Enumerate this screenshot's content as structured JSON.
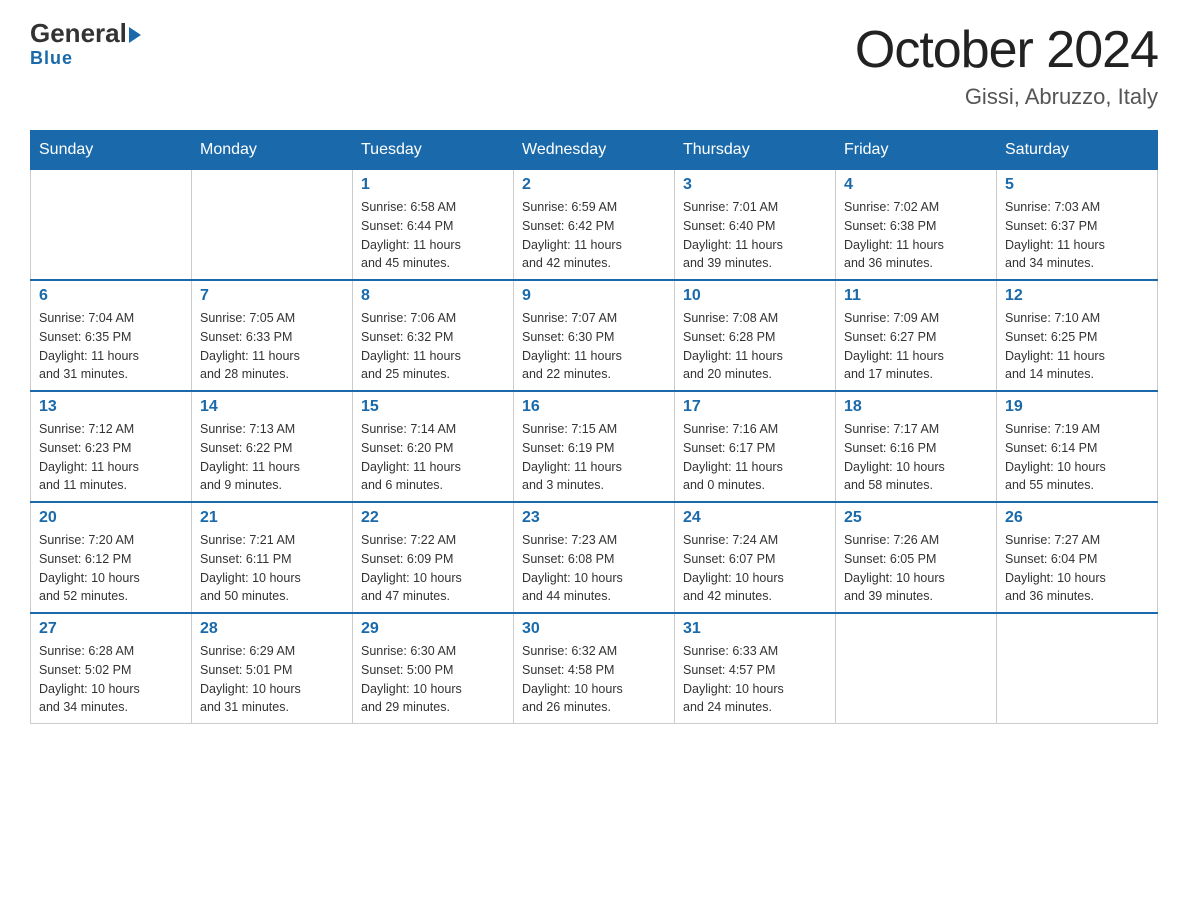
{
  "header": {
    "logo_general": "General",
    "logo_blue": "Blue",
    "month_title": "October 2024",
    "location": "Gissi, Abruzzo, Italy"
  },
  "days_of_week": [
    "Sunday",
    "Monday",
    "Tuesday",
    "Wednesday",
    "Thursday",
    "Friday",
    "Saturday"
  ],
  "weeks": [
    [
      {
        "day": "",
        "info": ""
      },
      {
        "day": "",
        "info": ""
      },
      {
        "day": "1",
        "info": "Sunrise: 6:58 AM\nSunset: 6:44 PM\nDaylight: 11 hours\nand 45 minutes."
      },
      {
        "day": "2",
        "info": "Sunrise: 6:59 AM\nSunset: 6:42 PM\nDaylight: 11 hours\nand 42 minutes."
      },
      {
        "day": "3",
        "info": "Sunrise: 7:01 AM\nSunset: 6:40 PM\nDaylight: 11 hours\nand 39 minutes."
      },
      {
        "day": "4",
        "info": "Sunrise: 7:02 AM\nSunset: 6:38 PM\nDaylight: 11 hours\nand 36 minutes."
      },
      {
        "day": "5",
        "info": "Sunrise: 7:03 AM\nSunset: 6:37 PM\nDaylight: 11 hours\nand 34 minutes."
      }
    ],
    [
      {
        "day": "6",
        "info": "Sunrise: 7:04 AM\nSunset: 6:35 PM\nDaylight: 11 hours\nand 31 minutes."
      },
      {
        "day": "7",
        "info": "Sunrise: 7:05 AM\nSunset: 6:33 PM\nDaylight: 11 hours\nand 28 minutes."
      },
      {
        "day": "8",
        "info": "Sunrise: 7:06 AM\nSunset: 6:32 PM\nDaylight: 11 hours\nand 25 minutes."
      },
      {
        "day": "9",
        "info": "Sunrise: 7:07 AM\nSunset: 6:30 PM\nDaylight: 11 hours\nand 22 minutes."
      },
      {
        "day": "10",
        "info": "Sunrise: 7:08 AM\nSunset: 6:28 PM\nDaylight: 11 hours\nand 20 minutes."
      },
      {
        "day": "11",
        "info": "Sunrise: 7:09 AM\nSunset: 6:27 PM\nDaylight: 11 hours\nand 17 minutes."
      },
      {
        "day": "12",
        "info": "Sunrise: 7:10 AM\nSunset: 6:25 PM\nDaylight: 11 hours\nand 14 minutes."
      }
    ],
    [
      {
        "day": "13",
        "info": "Sunrise: 7:12 AM\nSunset: 6:23 PM\nDaylight: 11 hours\nand 11 minutes."
      },
      {
        "day": "14",
        "info": "Sunrise: 7:13 AM\nSunset: 6:22 PM\nDaylight: 11 hours\nand 9 minutes."
      },
      {
        "day": "15",
        "info": "Sunrise: 7:14 AM\nSunset: 6:20 PM\nDaylight: 11 hours\nand 6 minutes."
      },
      {
        "day": "16",
        "info": "Sunrise: 7:15 AM\nSunset: 6:19 PM\nDaylight: 11 hours\nand 3 minutes."
      },
      {
        "day": "17",
        "info": "Sunrise: 7:16 AM\nSunset: 6:17 PM\nDaylight: 11 hours\nand 0 minutes."
      },
      {
        "day": "18",
        "info": "Sunrise: 7:17 AM\nSunset: 6:16 PM\nDaylight: 10 hours\nand 58 minutes."
      },
      {
        "day": "19",
        "info": "Sunrise: 7:19 AM\nSunset: 6:14 PM\nDaylight: 10 hours\nand 55 minutes."
      }
    ],
    [
      {
        "day": "20",
        "info": "Sunrise: 7:20 AM\nSunset: 6:12 PM\nDaylight: 10 hours\nand 52 minutes."
      },
      {
        "day": "21",
        "info": "Sunrise: 7:21 AM\nSunset: 6:11 PM\nDaylight: 10 hours\nand 50 minutes."
      },
      {
        "day": "22",
        "info": "Sunrise: 7:22 AM\nSunset: 6:09 PM\nDaylight: 10 hours\nand 47 minutes."
      },
      {
        "day": "23",
        "info": "Sunrise: 7:23 AM\nSunset: 6:08 PM\nDaylight: 10 hours\nand 44 minutes."
      },
      {
        "day": "24",
        "info": "Sunrise: 7:24 AM\nSunset: 6:07 PM\nDaylight: 10 hours\nand 42 minutes."
      },
      {
        "day": "25",
        "info": "Sunrise: 7:26 AM\nSunset: 6:05 PM\nDaylight: 10 hours\nand 39 minutes."
      },
      {
        "day": "26",
        "info": "Sunrise: 7:27 AM\nSunset: 6:04 PM\nDaylight: 10 hours\nand 36 minutes."
      }
    ],
    [
      {
        "day": "27",
        "info": "Sunrise: 6:28 AM\nSunset: 5:02 PM\nDaylight: 10 hours\nand 34 minutes."
      },
      {
        "day": "28",
        "info": "Sunrise: 6:29 AM\nSunset: 5:01 PM\nDaylight: 10 hours\nand 31 minutes."
      },
      {
        "day": "29",
        "info": "Sunrise: 6:30 AM\nSunset: 5:00 PM\nDaylight: 10 hours\nand 29 minutes."
      },
      {
        "day": "30",
        "info": "Sunrise: 6:32 AM\nSunset: 4:58 PM\nDaylight: 10 hours\nand 26 minutes."
      },
      {
        "day": "31",
        "info": "Sunrise: 6:33 AM\nSunset: 4:57 PM\nDaylight: 10 hours\nand 24 minutes."
      },
      {
        "day": "",
        "info": ""
      },
      {
        "day": "",
        "info": ""
      }
    ]
  ]
}
